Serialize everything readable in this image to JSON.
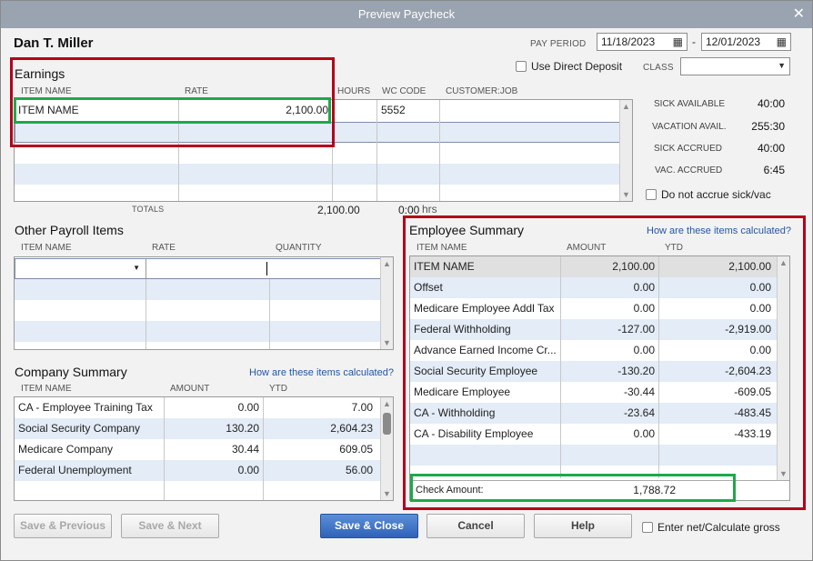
{
  "window": {
    "title": "Preview Paycheck",
    "close": "✕"
  },
  "employee_name": "Dan T. Miller",
  "pay_period": {
    "label": "PAY PERIOD",
    "start": "11/18/2023",
    "separator": "-",
    "end": "12/01/2023"
  },
  "direct_deposit": {
    "label": "Use Direct Deposit",
    "checked": false
  },
  "class_field": {
    "label": "CLASS",
    "value": ""
  },
  "earnings": {
    "title": "Earnings",
    "headers": [
      "ITEM NAME",
      "RATE",
      "HOURS",
      "WC CODE",
      "CUSTOMER:JOB"
    ],
    "rows": [
      {
        "item": "ITEM NAME",
        "rate": "2,100.00",
        "hours": "",
        "wc": "5552",
        "job": ""
      }
    ],
    "totals_label": "TOTALS",
    "totals_rate": "2,100.00",
    "totals_hours": "0:00",
    "totals_hours_unit": "hrs"
  },
  "sick_vac": {
    "items": [
      {
        "label": "SICK AVAILABLE",
        "value": "40:00"
      },
      {
        "label": "VACATION AVAIL.",
        "value": "255:30"
      },
      {
        "label": "SICK ACCRUED",
        "value": "40:00"
      },
      {
        "label": "VAC. ACCRUED",
        "value": "6:45"
      }
    ],
    "do_not_accrue": "Do not accrue sick/vac"
  },
  "other_payroll": {
    "title": "Other Payroll Items",
    "headers": [
      "ITEM NAME",
      "RATE",
      "QUANTITY"
    ]
  },
  "company_summary": {
    "title": "Company Summary",
    "link": "How are these items calculated?",
    "headers": [
      "ITEM NAME",
      "AMOUNT",
      "YTD"
    ],
    "rows": [
      {
        "item": "CA - Employee Training Tax",
        "amount": "0.00",
        "ytd": "7.00"
      },
      {
        "item": "Social Security Company",
        "amount": "130.20",
        "ytd": "2,604.23"
      },
      {
        "item": "Medicare Company",
        "amount": "30.44",
        "ytd": "609.05"
      },
      {
        "item": "Federal Unemployment",
        "amount": "0.00",
        "ytd": "56.00"
      }
    ]
  },
  "employee_summary": {
    "title": "Employee Summary",
    "link": "How are these items calculated?",
    "headers": [
      "ITEM NAME",
      "AMOUNT",
      "YTD"
    ],
    "rows": [
      {
        "item": "ITEM NAME",
        "amount": "2,100.00",
        "ytd": "2,100.00"
      },
      {
        "item": "Offset",
        "amount": "0.00",
        "ytd": "0.00"
      },
      {
        "item": "Medicare Employee Addl Tax",
        "amount": "0.00",
        "ytd": "0.00"
      },
      {
        "item": "Federal Withholding",
        "amount": "-127.00",
        "ytd": "-2,919.00"
      },
      {
        "item": "Advance Earned Income Cr...",
        "amount": "0.00",
        "ytd": "0.00"
      },
      {
        "item": "Social Security Employee",
        "amount": "-130.20",
        "ytd": "-2,604.23"
      },
      {
        "item": "Medicare Employee",
        "amount": "-30.44",
        "ytd": "-609.05"
      },
      {
        "item": "CA - Withholding",
        "amount": "-23.64",
        "ytd": "-483.45"
      },
      {
        "item": "CA - Disability Employee",
        "amount": "0.00",
        "ytd": "-433.19"
      }
    ],
    "check_amount_label": "Check Amount:",
    "check_amount": "1,788.72"
  },
  "buttons": {
    "save_previous": "Save & Previous",
    "save_next": "Save & Next",
    "save_close": "Save & Close",
    "cancel": "Cancel",
    "help": "Help"
  },
  "enter_net": {
    "label": "Enter net/Calculate gross",
    "checked": false
  },
  "colors": {
    "highlight_red": "#b3001b",
    "highlight_green": "#1fa84a",
    "primary_button": "#2f62b8",
    "row_alt": "#e3ecf7"
  }
}
